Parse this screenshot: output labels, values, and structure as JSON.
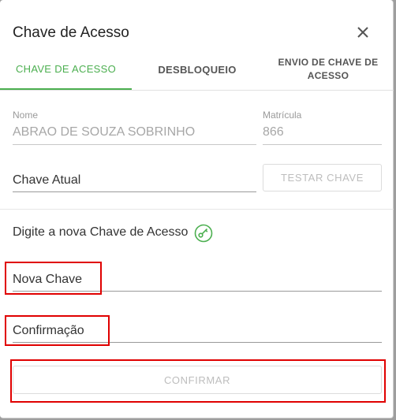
{
  "dialog": {
    "title": "Chave de Acesso"
  },
  "tabs": [
    {
      "label": "CHAVE DE ACESSO",
      "active": true
    },
    {
      "label": "DESBLOQUEIO",
      "active": false
    },
    {
      "label": "ENVIO DE CHAVE DE ACESSO",
      "active": false
    }
  ],
  "form": {
    "nome_label": "Nome",
    "nome_value": "ABRAO  DE SOUZA SOBRINHO",
    "matricula_label": "Matrícula",
    "matricula_value": "866",
    "chave_atual_label": "Chave Atual",
    "testar_button": "TESTAR CHAVE",
    "prompt": "Digite a nova Chave de Acesso",
    "nova_chave_label": "Nova Chave",
    "confirmacao_label": "Confirmação",
    "confirmar_button": "CONFIRMAR"
  },
  "icons": {
    "close": "close-icon",
    "key": "key-icon"
  },
  "colors": {
    "accent": "#4caf50",
    "highlight": "#e00000"
  }
}
